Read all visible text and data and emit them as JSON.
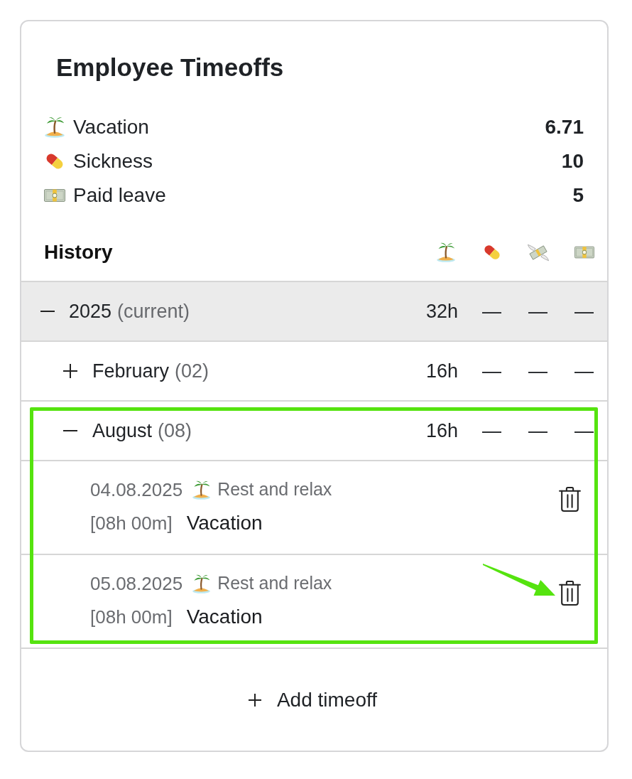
{
  "card": {
    "title": "Employee Timeoffs"
  },
  "balances": [
    {
      "kind": "palm",
      "label": "Vacation",
      "value": "6.71"
    },
    {
      "kind": "pill",
      "label": "Sickness",
      "value": "10"
    },
    {
      "kind": "banknote",
      "label": "Paid leave",
      "value": "5"
    }
  ],
  "history": {
    "title": "History",
    "columns": [
      {
        "kind": "palm"
      },
      {
        "kind": "pill"
      },
      {
        "kind": "wingedmoney"
      },
      {
        "kind": "banknote"
      }
    ],
    "rows": [
      {
        "kind": "year",
        "label": "2025",
        "note": "(current)",
        "expanded": true,
        "values": [
          "32h",
          "—",
          "—",
          "—"
        ],
        "children": [
          {
            "kind": "month",
            "label": "February",
            "note": "(02)",
            "expanded": false,
            "highlighted": false,
            "values": [
              "16h",
              "—",
              "—",
              "—"
            ]
          },
          {
            "kind": "month",
            "label": "August",
            "note": "(08)",
            "expanded": true,
            "highlighted": true,
            "values": [
              "16h",
              "—",
              "—",
              "—"
            ],
            "entries": [
              {
                "kind": "palm",
                "date": "04.08.2025",
                "comment": "Rest and relax",
                "duration": "[08h 00m]",
                "type": "Vacation",
                "pointed": false
              },
              {
                "kind": "palm",
                "date": "05.08.2025",
                "comment": "Rest and relax",
                "duration": "[08h 00m]",
                "type": "Vacation",
                "pointed": true
              }
            ]
          }
        ]
      }
    ]
  },
  "add_button": {
    "label": "Add timeoff"
  }
}
